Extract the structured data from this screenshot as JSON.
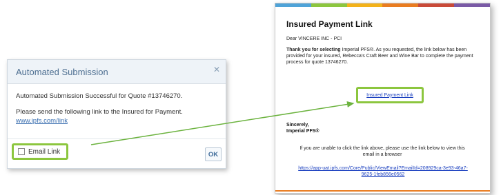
{
  "dialog": {
    "title": "Automated Submission",
    "close_glyph": "✕",
    "message": "Automated Submission Successful for Quote #13746270.",
    "instruction": "Please send the following link to the Insured for Payment.",
    "link_text": "www.ipfs.com/link",
    "email_link_label": "Email Link",
    "email_link_checked": false,
    "ok_label": "OK"
  },
  "email": {
    "title": "Insured Payment Link",
    "salutation": "Dear VINCERE INC - PCI",
    "thanks_bold": "Thank you for selecting",
    "thanks_rest": " Imperial PFS®. As you requested, the link below has been provided for your insured, Rebecca's Craft Beer and Wine Bar to complete the payment process for quote 13746270.",
    "payment_link": "Insured Payment Link",
    "signoff": "Sincerely,",
    "signature": "Imperial PFS®",
    "unable_text": "If you are unable to click the link above, please use the link below to view this email in a browser",
    "browser_url": "https://app-uat.ipfs.com/Core/Public/ViewEmail?EmailId=208929ca-3e93-46a7-9625-1feb856e0562",
    "header_colors": [
      "#4fa3d8",
      "#8cc63e",
      "#f3b21a",
      "#e97c20",
      "#c94a38",
      "#7a5aa6"
    ]
  },
  "annotations": {
    "highlight_color": "#8cc63e",
    "arrow_color": "#6cb33f"
  }
}
